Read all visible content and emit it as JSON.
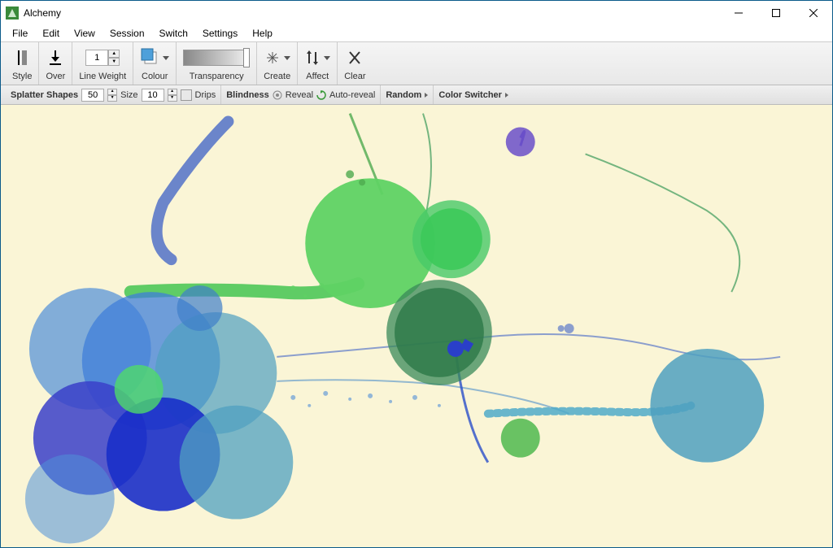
{
  "window": {
    "title": "Alchemy"
  },
  "menu": {
    "items": [
      "File",
      "Edit",
      "View",
      "Session",
      "Switch",
      "Settings",
      "Help"
    ]
  },
  "toolbar": {
    "style": "Style",
    "over": "Over",
    "line_weight": "Line Weight",
    "line_weight_value": "1",
    "colour": "Colour",
    "transparency": "Transparency",
    "create": "Create",
    "affect": "Affect",
    "clear": "Clear"
  },
  "subbar": {
    "splatter_shapes": "Splatter Shapes",
    "splatter_value": "50",
    "size_label": "Size",
    "size_value": "10",
    "drips": "Drips",
    "blindness": "Blindness",
    "reveal": "Reveal",
    "auto_reveal": "Auto-reveal",
    "random": "Random",
    "color_switcher": "Color Switcher"
  },
  "colors": {
    "swatch_main": "#4ea0da",
    "swatch_bg": "#ffffff"
  }
}
